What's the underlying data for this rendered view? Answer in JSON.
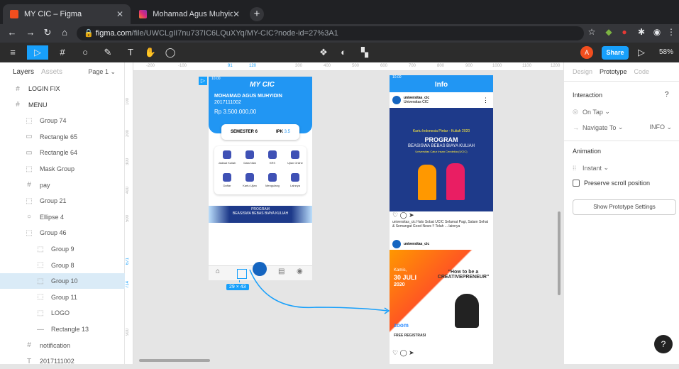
{
  "browser": {
    "tabs": [
      {
        "title": "MY CIC – Figma"
      },
      {
        "title": "Mohamad Agus Muhyidin (@m..."
      }
    ],
    "url_host": "figma.com",
    "url_path": "/file/UWCLgII7nu737IC6LQuXYq/MY-CIC?node-id=27%3A1"
  },
  "toolbar": {
    "avatar_letter": "A",
    "share_label": "Share",
    "zoom": "58%"
  },
  "layers_panel": {
    "tab_layers": "Layers",
    "tab_assets": "Assets",
    "page": "Page 1",
    "items": [
      {
        "label": "LOGIN FIX",
        "icon": "#"
      },
      {
        "label": "MENU",
        "icon": "#"
      },
      {
        "label": "Group 74",
        "icon": "⬚"
      },
      {
        "label": "Rectangle 65",
        "icon": "▭"
      },
      {
        "label": "Rectangle 64",
        "icon": "▭"
      },
      {
        "label": "Mask Group",
        "icon": "⬚"
      },
      {
        "label": "pay",
        "icon": "#"
      },
      {
        "label": "Group 21",
        "icon": "⬚"
      },
      {
        "label": "Ellipse 4",
        "icon": "○"
      },
      {
        "label": "Group 46",
        "icon": "⬚"
      },
      {
        "label": "Group 9",
        "icon": "⬚"
      },
      {
        "label": "Group 8",
        "icon": "⬚"
      },
      {
        "label": "Group 10",
        "icon": "⬚"
      },
      {
        "label": "Group 11",
        "icon": "⬚"
      },
      {
        "label": "LOGO",
        "icon": "⬚"
      },
      {
        "label": "Rectangle 13",
        "icon": "—"
      },
      {
        "label": "notification",
        "icon": "#"
      },
      {
        "label": "2017111002",
        "icon": "T"
      }
    ]
  },
  "canvas": {
    "ruler_top": [
      "-200",
      "-100",
      "91",
      "120",
      "300",
      "400",
      "500",
      "600",
      "700",
      "800",
      "900",
      "1000",
      "1100",
      "1200"
    ],
    "ruler_left": [
      "100",
      "200",
      "300",
      "400",
      "500",
      "671",
      "714",
      "900"
    ],
    "selection_size": "29 × 43",
    "frame_menu": {
      "name": "MY CIC",
      "time": "10.00",
      "user": "MOHAMAD AGUS MUHYIDIN",
      "nim": "2017111002",
      "balance": "3.500.000,00",
      "semester": "SEMESTER 6",
      "ipk_label": "IPK",
      "ipk_value": "3.5",
      "menu_items": [
        "Jadwal Kuliah",
        "Data Nilai",
        "KRS",
        "Ujian Online",
        "Daftar",
        "Kartu Ujian",
        "Mengulang",
        "Lainnya"
      ],
      "banner_title": "PROGRAM",
      "banner_sub": "BEASISWA BEBAS BIAYA KULIAH",
      "nav_labels": [
        "Beranda",
        "",
        "",
        "",
        "Akun"
      ]
    },
    "frame_info": {
      "title": "Info",
      "time": "10.00",
      "account": "universitas_cic",
      "account_sub": "Universitas CIC",
      "post1_title": "Kartu Indonesia Pintar - Kuliah 2020",
      "post1_big": "PROGRAM",
      "post1_line2": "BEASISWA BEBAS BIAYA KULIAH",
      "post1_line3": "Universitas Catur Insan Cendekia (UCIC)",
      "caption": "universitas_cic Halo Sobat UCIC Selamat Pagi, Salam Sehat & Semangat Good News !! Telah ... lainnya",
      "post2_date1": "Kamis,",
      "post2_date2": "30 JULI",
      "post2_year": "2020",
      "post2_title": "\"How to be a CREATIVEPRENEUR\"",
      "zoom_label": "zoom",
      "registration": "FREE REGISTRASI"
    }
  },
  "properties_panel": {
    "tabs": [
      "Design",
      "Prototype",
      "Code"
    ],
    "active_tab": "Prototype",
    "interaction_title": "Interaction",
    "trigger": "On Tap",
    "action": "Navigate To",
    "destination": "INFO",
    "animation_title": "Animation",
    "animation": "Instant",
    "preserve_scroll": "Preserve scroll position",
    "settings_button": "Show Prototype Settings"
  },
  "colors": {
    "figma_dark": "#2c2c2c",
    "accent": "#18a0fb",
    "app_blue": "#2196f3",
    "selection_bg": "#daebf7"
  }
}
